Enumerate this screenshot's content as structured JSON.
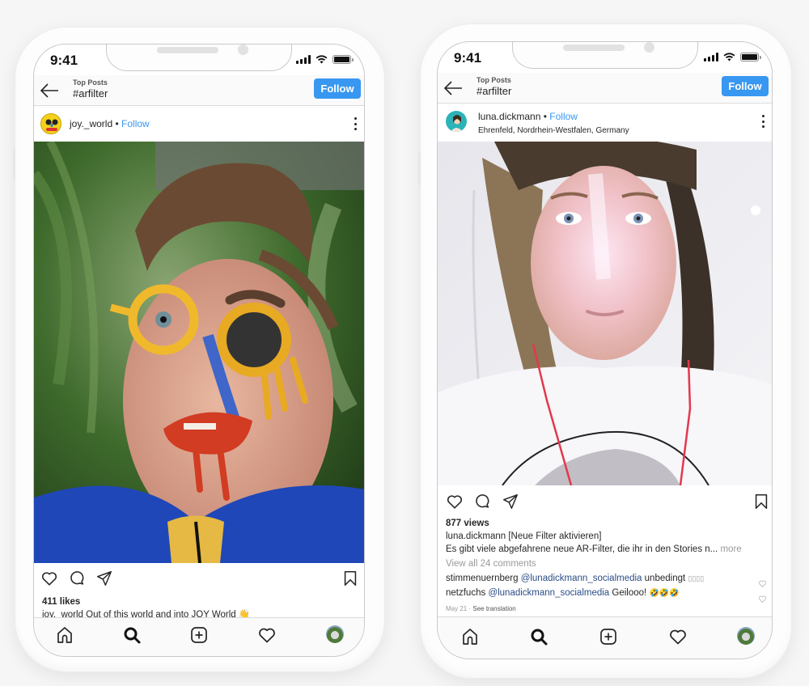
{
  "phones": [
    {
      "status": {
        "time": "9:41"
      },
      "nav": {
        "subtitle": "Top Posts",
        "title": "#arfilter",
        "follow_label": "Follow"
      },
      "post": {
        "username": "joy._world",
        "separator": "•",
        "follow_label": "Follow",
        "location": "",
        "photo_description": "Man with AR filter: melting yellow glasses, blue drip nose, red lips, blue jacket, green foliage background",
        "count_text": "411 likes",
        "caption": {
          "user": "joy._world",
          "text": "Out of this world and into JOY World",
          "emoji": "👋"
        }
      }
    },
    {
      "status": {
        "time": "9:41"
      },
      "nav": {
        "subtitle": "Top Posts",
        "title": "#arfilter",
        "follow_label": "Follow"
      },
      "post": {
        "username": "luna.dickmann",
        "separator": "•",
        "follow_label": "Follow",
        "location": "Ehrenfeld, Nordrhein-Westfalen, Germany",
        "photo_description": "Woman with holographic light AR filter, white t-shirt, red earphones",
        "count_text": "877 views",
        "caption": {
          "user": "luna.dickmann",
          "text": "[Neue Filter aktivieren]",
          "second_line": "Es gibt viele abgefahrene neue AR-Filter, die ihr in den Stories n...",
          "more_label": "more"
        },
        "view_all_comments": "View all 24 comments",
        "comments": [
          {
            "user": "stimmenuernberg",
            "mention": "@lunadickmann_socialmedia",
            "text": "unbedingt",
            "emoji": "▯▯▯▯"
          },
          {
            "user": "netzfuchs",
            "mention": "@lunadickmann_socialmedia",
            "text": "Geilooo!",
            "emoji": "🤣🤣🤣"
          }
        ],
        "date": "May 21",
        "translation_label": "See translation"
      }
    }
  ],
  "icons": {
    "back": "arrow-left",
    "more": "three-dots-vertical",
    "like": "heart-outline",
    "comment": "speech-bubble",
    "share": "paper-plane",
    "save": "bookmark",
    "tabs": [
      "home",
      "search",
      "add-post",
      "activity-heart",
      "profile-avatar"
    ]
  },
  "colors": {
    "accent_blue": "#3897f0",
    "mention_blue": "#2b4c86",
    "muted_gray": "#9a9a9a",
    "text": "#262626"
  }
}
